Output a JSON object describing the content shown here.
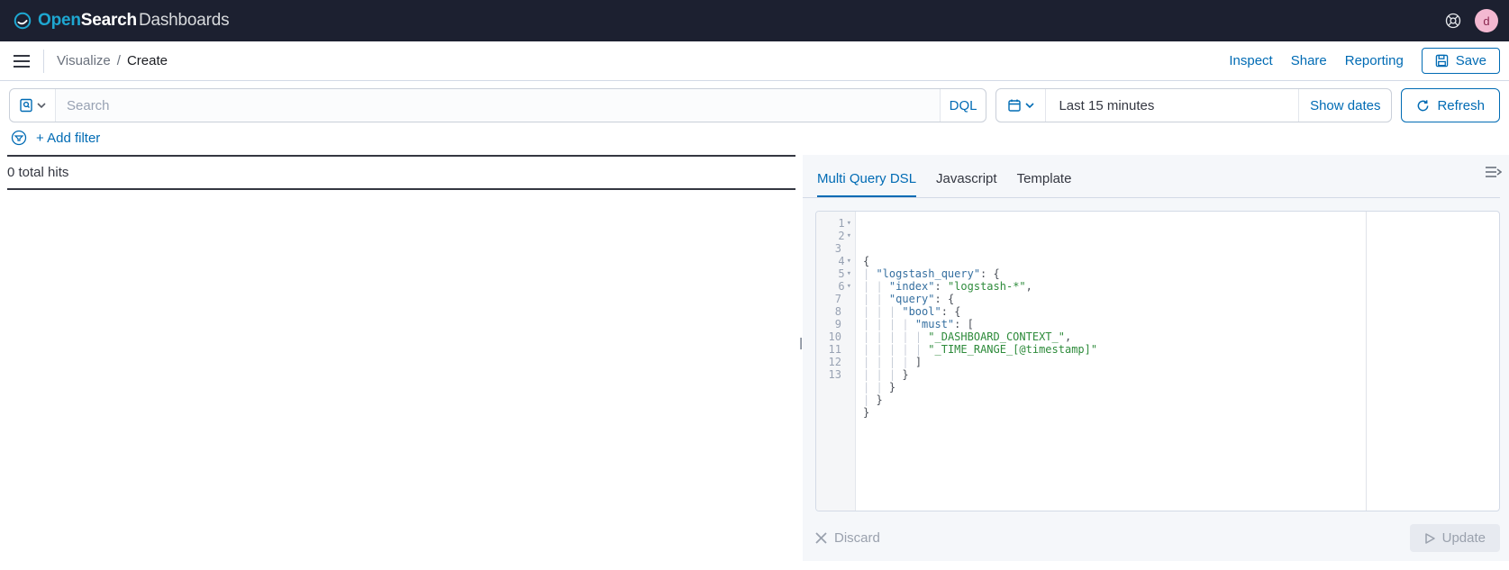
{
  "brand": {
    "open": "Open",
    "search": "Search",
    "dash": "Dashboards"
  },
  "avatar": {
    "initial": "d"
  },
  "breadcrumb": {
    "parent": "Visualize",
    "current": "Create"
  },
  "sub_actions": {
    "inspect": "Inspect",
    "share": "Share",
    "reporting": "Reporting",
    "save": "Save"
  },
  "querybar": {
    "search_placeholder": "Search",
    "dql": "DQL"
  },
  "datebar": {
    "range": "Last 15 minutes",
    "show_dates": "Show dates",
    "refresh": "Refresh"
  },
  "filters": {
    "add": "+ Add filter"
  },
  "results": {
    "hits_text": "0 total hits"
  },
  "tabs": {
    "t1": "Multi Query DSL",
    "t2": "Javascript",
    "t3": "Template"
  },
  "editor": {
    "lines": [
      {
        "n": 1,
        "fold": true,
        "t": "{"
      },
      {
        "n": 2,
        "fold": true,
        "t": "  \"logstash_query\": {"
      },
      {
        "n": 3,
        "fold": false,
        "t": "    \"index\": \"logstash-*\","
      },
      {
        "n": 4,
        "fold": true,
        "t": "    \"query\": {"
      },
      {
        "n": 5,
        "fold": true,
        "t": "      \"bool\": {"
      },
      {
        "n": 6,
        "fold": true,
        "t": "        \"must\": ["
      },
      {
        "n": 7,
        "fold": false,
        "t": "          \"_DASHBOARD_CONTEXT_\","
      },
      {
        "n": 8,
        "fold": false,
        "t": "          \"_TIME_RANGE_[@timestamp]\""
      },
      {
        "n": 9,
        "fold": false,
        "t": "        ]"
      },
      {
        "n": 10,
        "fold": false,
        "t": "      }"
      },
      {
        "n": 11,
        "fold": false,
        "t": "    }"
      },
      {
        "n": 12,
        "fold": false,
        "t": "  }"
      },
      {
        "n": 13,
        "fold": false,
        "t": "}"
      }
    ],
    "active_line": 13
  },
  "bottom": {
    "discard": "Discard",
    "update": "Update"
  }
}
